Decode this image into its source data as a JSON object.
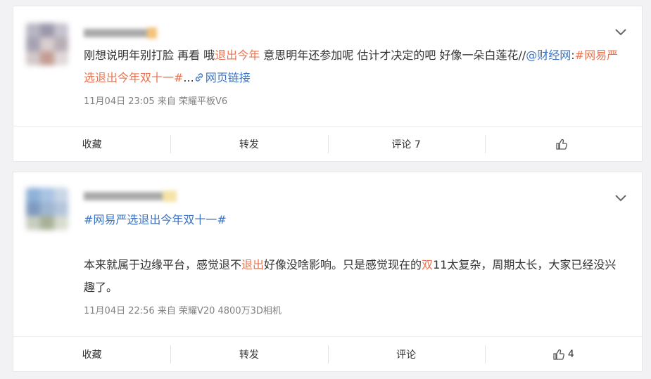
{
  "posts": [
    {
      "text_parts": [
        {
          "t": "刚想说明年别打脸 再看 哦",
          "c": "plain"
        },
        {
          "t": "退出今年",
          "c": "hl"
        },
        {
          "t": " 意思明年还参加呢 估计才决定的吧 好像一朵白莲花//",
          "c": "plain"
        },
        {
          "t": "@财经网",
          "c": "link"
        },
        {
          "t": ":",
          "c": "plain"
        },
        {
          "t": "#网易严选退出今年双十一#",
          "c": "tag"
        },
        {
          "t": "...",
          "c": "plain"
        },
        {
          "t": "网页链接",
          "c": "link",
          "icon": "link-icon"
        }
      ],
      "meta": "11月04日 23:05  来自 荣耀平板V6",
      "actions": {
        "collect": "收藏",
        "forward": "转发",
        "comment": "评论 7",
        "like_count": ""
      }
    },
    {
      "topic": "#网易严选退出今年双十一#",
      "text_parts": [
        {
          "t": "本来就属于边缘平台，感觉退不",
          "c": "plain"
        },
        {
          "t": "退出",
          "c": "hl"
        },
        {
          "t": "好像没啥影响。只是感觉现在的",
          "c": "plain"
        },
        {
          "t": "双",
          "c": "hl"
        },
        {
          "t": "11太复杂，周期太长，大家已经没兴趣了。",
          "c": "plain"
        }
      ],
      "meta": "11月04日 22:56  来自 荣耀V20 4800万3D相机",
      "actions": {
        "collect": "收藏",
        "forward": "转发",
        "comment": "评论",
        "like_count": "4"
      }
    }
  ],
  "colors": {
    "highlight": "#eb7350",
    "link": "#3a73c4",
    "meta": "#808080"
  }
}
